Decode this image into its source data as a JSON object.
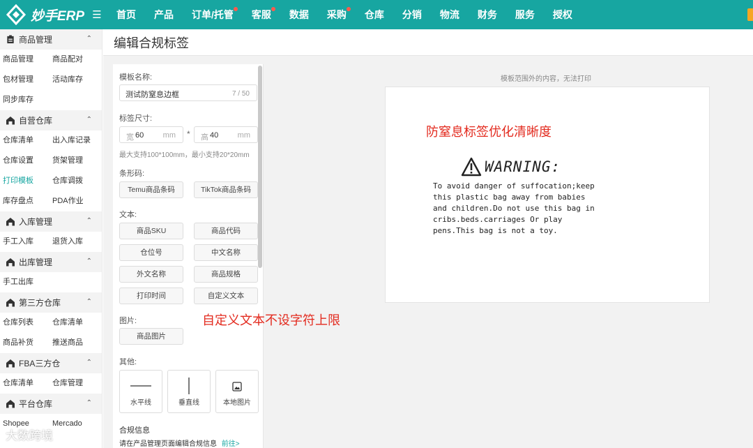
{
  "app": {
    "name": "妙手ERP",
    "menu_icon": "hamburger-icon"
  },
  "topnav": [
    {
      "label": "首页",
      "dot": false
    },
    {
      "label": "产品",
      "dot": false
    },
    {
      "label": "订单/托管",
      "dot": true
    },
    {
      "label": "客服",
      "dot": true
    },
    {
      "label": "数据",
      "dot": false
    },
    {
      "label": "采购",
      "dot": true
    },
    {
      "label": "仓库",
      "dot": false
    },
    {
      "label": "分销",
      "dot": false
    },
    {
      "label": "物流",
      "dot": false
    },
    {
      "label": "财务",
      "dot": false
    },
    {
      "label": "服务",
      "dot": false
    },
    {
      "label": "授权",
      "dot": false
    }
  ],
  "sidebar": {
    "groups": [
      {
        "title": "商品管理",
        "icon": "clipboard-icon",
        "items": [
          "商品管理",
          "商品配对",
          "包材管理",
          "活动库存",
          "同步库存"
        ]
      },
      {
        "title": "自营仓库",
        "icon": "warehouse-icon",
        "items": [
          "仓库清单",
          "出入库记录",
          "仓库设置",
          "货架管理",
          "打印模板",
          "仓库调拨",
          "库存盘点",
          "PDA作业"
        ],
        "active": "打印模板"
      },
      {
        "title": "入库管理",
        "icon": "warehouse-icon",
        "items": [
          "手工入库",
          "退货入库"
        ]
      },
      {
        "title": "出库管理",
        "icon": "warehouse-icon",
        "items": [
          "手工出库"
        ]
      },
      {
        "title": "第三方仓库",
        "icon": "warehouse-icon",
        "items": [
          "仓库列表",
          "仓库清单",
          "商品补货",
          "推送商品"
        ]
      },
      {
        "title": "FBA三方仓",
        "icon": "warehouse-icon",
        "items": [
          "仓库清单",
          "仓库管理"
        ]
      },
      {
        "title": "平台仓库",
        "icon": "warehouse-icon",
        "items": [
          "Shopee",
          "Mercado"
        ]
      }
    ]
  },
  "page": {
    "title": "编辑合规标签"
  },
  "form": {
    "template_name_label": "模板名称:",
    "template_name_value": "测试防窒息边框",
    "template_name_count": "7 / 50",
    "size_label": "标签尺寸:",
    "width_prefix": "宽",
    "width_value": "60",
    "height_prefix": "高",
    "height_value": "40",
    "unit": "mm",
    "times": "*",
    "size_note": "最大支持100*100mm，最小支持20*20mm",
    "barcode_label": "条形码:",
    "barcode_buttons": [
      "Temu商品条码",
      "TikTok商品条码"
    ],
    "text_label": "文本:",
    "text_buttons": [
      "商品SKU",
      "商品代码",
      "仓位号",
      "中文名称",
      "外文名称",
      "商品规格",
      "打印时间",
      "自定义文本"
    ],
    "image_label": "图片:",
    "image_buttons": [
      "商品图片"
    ],
    "other_label": "其他:",
    "other_tools": [
      {
        "label": "水平线",
        "icon": "horizontal-line-icon"
      },
      {
        "label": "垂直线",
        "icon": "vertical-line-icon"
      },
      {
        "label": "本地图片",
        "icon": "image-icon"
      }
    ],
    "compliance_label": "合规信息",
    "compliance_note": "请在产品管理页面编辑合规信息",
    "compliance_link": "前往>"
  },
  "canvas": {
    "note": "模板范围外的内容，无法打印",
    "warning_title": "WARNING:",
    "warning_icon": "warning-triangle-icon",
    "warning_lines": [
      "To avoid danger of suffocation;keep",
      "this plastic bag away from babies",
      "and children.Do not use this bag in",
      "cribs.beds.carriages Or play",
      "pens.This bag is not a toy."
    ]
  },
  "annotations": {
    "top": "防窒息标签优化清晰度",
    "middle": "自定义文本不设字符上限"
  },
  "watermark": "大数跨境",
  "colors": {
    "brand": "#17a6a1",
    "annotation": "#e32b1f",
    "nav_dot": "#ff5a4e"
  }
}
